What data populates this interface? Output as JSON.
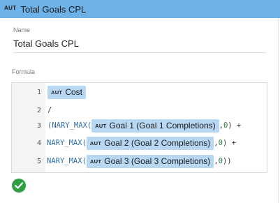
{
  "header": {
    "type_tag": "AUT",
    "title": "Total Goals CPL"
  },
  "name_field": {
    "label": "Name",
    "value": "Total  Goals CPL"
  },
  "formula": {
    "label": "Formula",
    "line_numbers": [
      "1",
      "2",
      "3",
      "4",
      "5"
    ],
    "line1": {
      "chip_tag": "AUT",
      "chip_label": "Cost"
    },
    "line2": {
      "op": "/"
    },
    "line3": {
      "prefix": "(NARY_MAX(",
      "chip_tag": "AUT",
      "chip_label": "Goal 1 (Goal 1 Completions)",
      "sep": ",",
      "num": "0",
      "suffix": ") +"
    },
    "line4": {
      "prefix": "NARY_MAX(",
      "chip_tag": "AUT",
      "chip_label": "Goal 2 (Goal 2 Completions)",
      "sep": ",",
      "num": "0",
      "suffix": ") +"
    },
    "line5": {
      "prefix": "NARY_MAX(",
      "chip_tag": "AUT",
      "chip_label": "Goal 3 (Goal 3 Completions)",
      "sep": ",",
      "num": "0",
      "suffix": "))"
    }
  },
  "status": {
    "icon": "check-circle-icon",
    "color": "#2f9e44"
  },
  "colors": {
    "header_bg": "#6fb2e8",
    "chip_bg": "#b7d7f3",
    "function_text": "#2f6fa8"
  }
}
